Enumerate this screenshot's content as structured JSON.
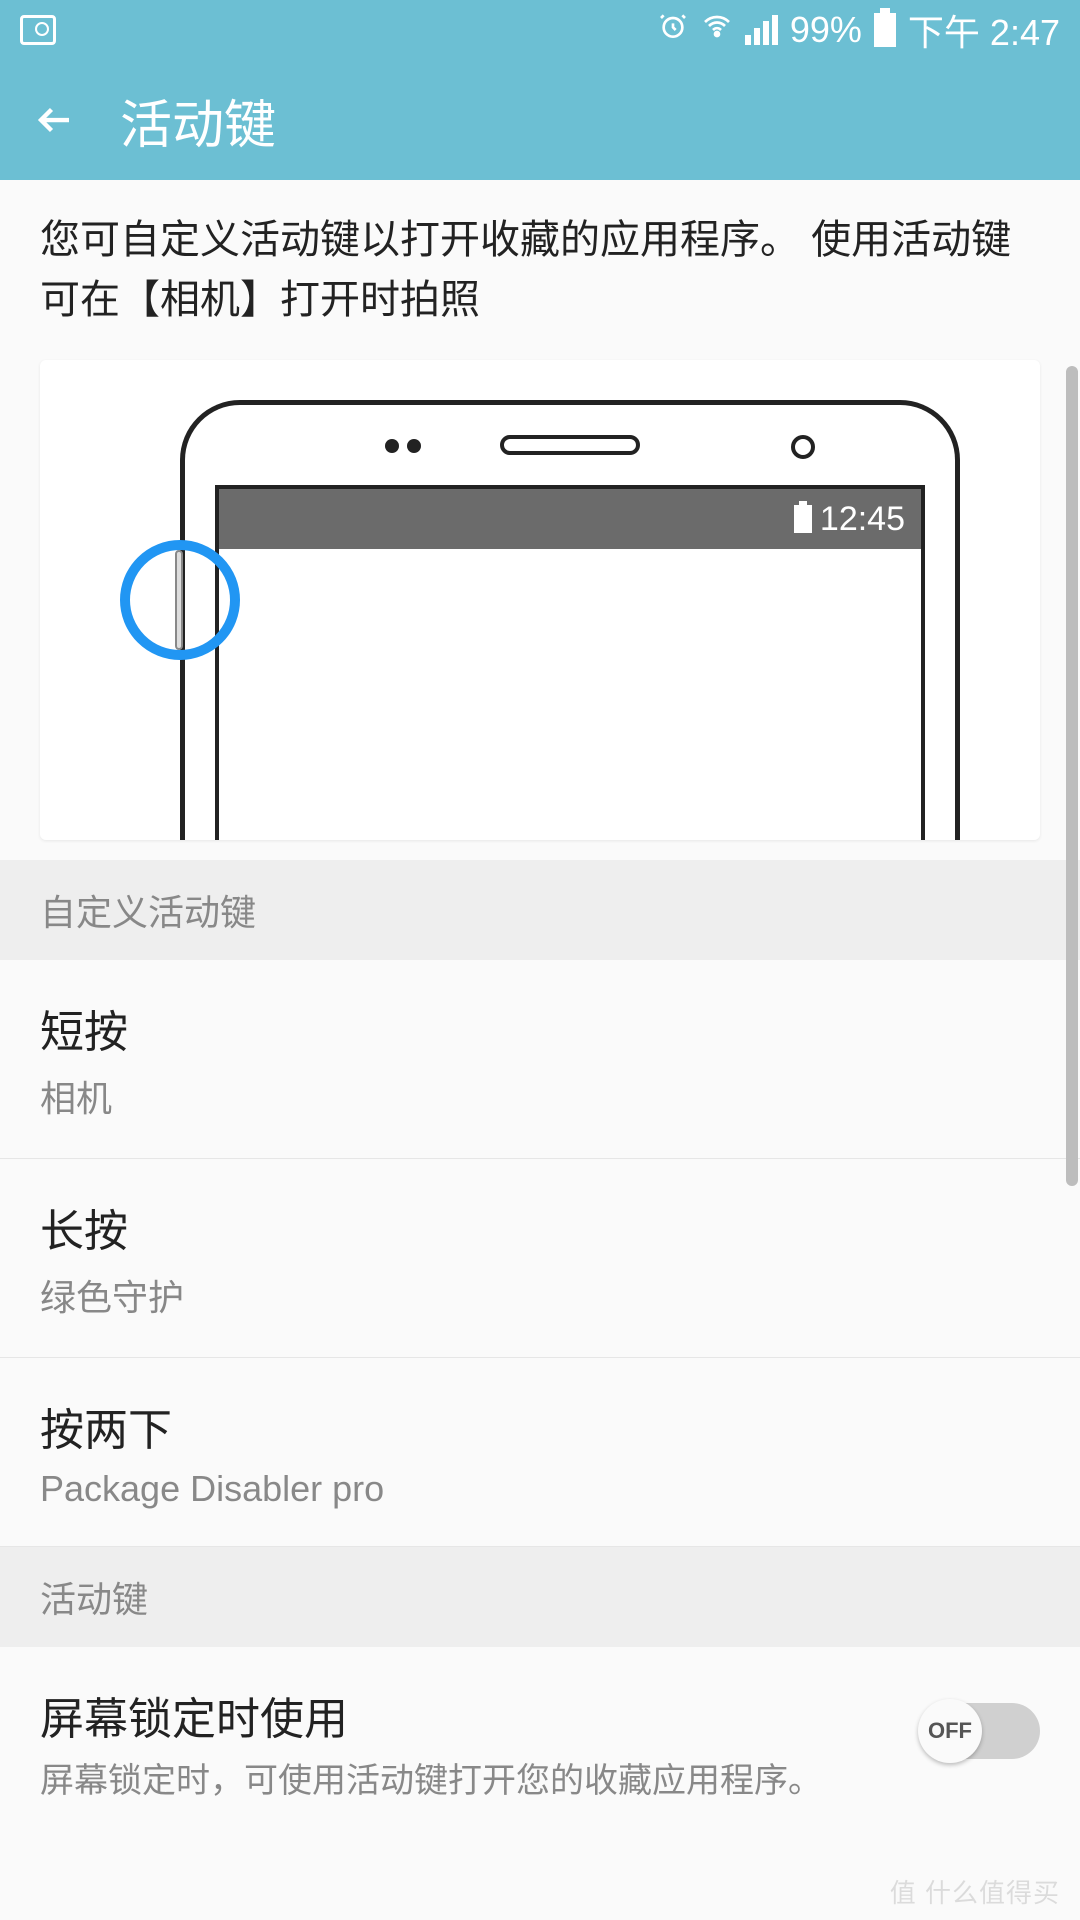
{
  "status": {
    "battery_pct": "99%",
    "time": "下午 2:47"
  },
  "header": {
    "title": "活动键"
  },
  "description": "您可自定义活动键以打开收藏的应用程序。 使用活动键可在【相机】打开时拍照",
  "illustration": {
    "phone_time": "12:45"
  },
  "section1": {
    "label": "自定义活动键",
    "items": [
      {
        "title": "短按",
        "subtitle": "相机"
      },
      {
        "title": "长按",
        "subtitle": "绿色守护"
      },
      {
        "title": "按两下",
        "subtitle": "Package Disabler pro"
      }
    ]
  },
  "section2": {
    "label": "活动键"
  },
  "switch_item": {
    "title": "屏幕锁定时使用",
    "desc": "屏幕锁定时，可使用活动键打开您的收藏应用程序。",
    "state": "OFF"
  },
  "watermark": "值 什么值得买"
}
